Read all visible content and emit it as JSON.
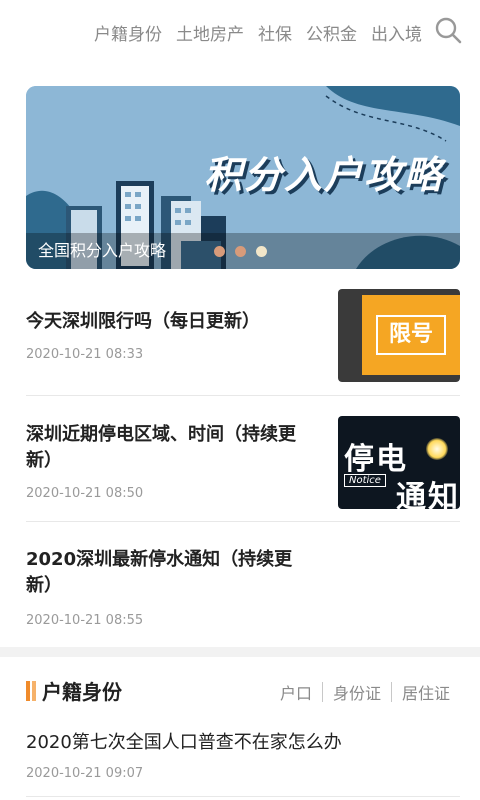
{
  "nav": {
    "categories": [
      "户籍身份",
      "土地房产",
      "社保",
      "公积金",
      "出入境"
    ],
    "search_icon": "search-icon"
  },
  "banner": {
    "image_title": "积分入户攻略",
    "caption": "全国积分入户攻略",
    "page_count": 3,
    "active_page": 3
  },
  "news": [
    {
      "title": "今天深圳限行吗（每日更新）",
      "date": "2020-10-21 08:33",
      "thumb_text": "限号"
    },
    {
      "title": "深圳近期停电区域、时间（持续更新）",
      "date": "2020-10-21 08:50",
      "thumb_text_1": "停电",
      "thumb_text_2": "通知",
      "thumb_badge": "Notice"
    },
    {
      "title": "2020深圳最新停水通知（持续更新）",
      "date": "2020-10-21 08:55"
    }
  ],
  "section": {
    "title": "户籍身份",
    "tabs": [
      "户口",
      "身份证",
      "居住证"
    ],
    "accent_color": "#f08b2b"
  },
  "section_items": [
    {
      "title": "2020第七次全国人口普查不在家怎么办",
      "date": "2020-10-21 09:07"
    }
  ]
}
